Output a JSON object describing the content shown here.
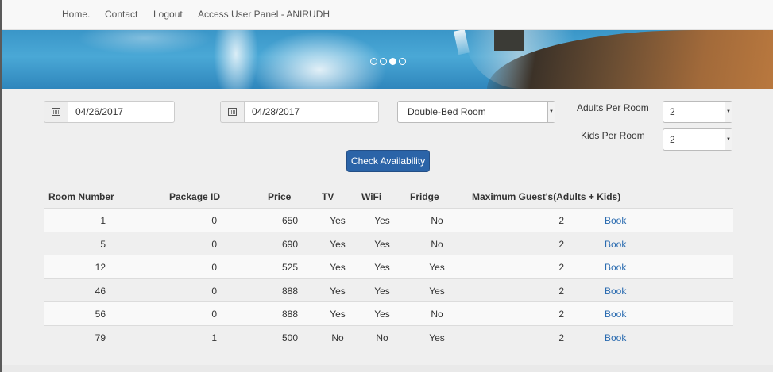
{
  "nav": {
    "home": "Home.",
    "contact": "Contact",
    "logout": "Logout",
    "user_panel": "Access User Panel - ANIRUDH"
  },
  "carousel": {
    "indicator_count": 4,
    "active_index": 2
  },
  "search": {
    "check_in": "04/26/2017",
    "check_out": "04/28/2017",
    "room_type": "Double-Bed Room",
    "adults_label": "Adults Per Room",
    "adults_value": "2",
    "kids_label": "Kids Per Room",
    "kids_value": "2",
    "check_button": "Check Availability",
    "calendar_icon": "calendar-icon"
  },
  "table": {
    "headers": {
      "room_number": "Room Number",
      "package_id": "Package ID",
      "price": "Price",
      "tv": "TV",
      "wifi": "WiFi",
      "fridge": "Fridge",
      "max_guests": "Maximum Guest's(Adults + Kids)"
    },
    "rows": [
      {
        "room": "1",
        "package": "0",
        "price": "650",
        "tv": "Yes",
        "wifi": "Yes",
        "fridge": "No",
        "guests": "2",
        "action": "Book"
      },
      {
        "room": "5",
        "package": "0",
        "price": "690",
        "tv": "Yes",
        "wifi": "Yes",
        "fridge": "No",
        "guests": "2",
        "action": "Book"
      },
      {
        "room": "12",
        "package": "0",
        "price": "525",
        "tv": "Yes",
        "wifi": "Yes",
        "fridge": "Yes",
        "guests": "2",
        "action": "Book"
      },
      {
        "room": "46",
        "package": "0",
        "price": "888",
        "tv": "Yes",
        "wifi": "Yes",
        "fridge": "Yes",
        "guests": "2",
        "action": "Book"
      },
      {
        "room": "56",
        "package": "0",
        "price": "888",
        "tv": "Yes",
        "wifi": "Yes",
        "fridge": "No",
        "guests": "2",
        "action": "Book"
      },
      {
        "room": "79",
        "package": "1",
        "price": "500",
        "tv": "No",
        "wifi": "No",
        "fridge": "Yes",
        "guests": "2",
        "action": "Book"
      }
    ]
  },
  "colors": {
    "button": "#2b64a8",
    "link": "#2a6bb0",
    "navbar": "#f8f8f8",
    "page": "#efefef"
  }
}
